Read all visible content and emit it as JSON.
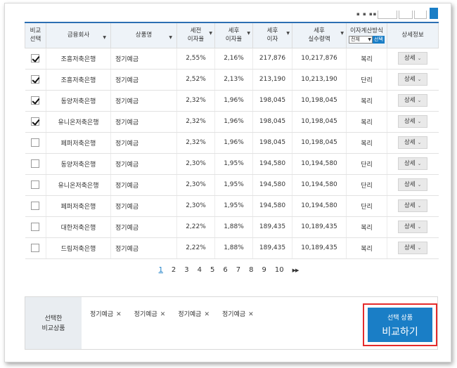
{
  "header": {
    "compare": "비교\n선택",
    "company": "금융회사",
    "product": "상품명",
    "pretax_rate": "세전\n이자율",
    "posttax_rate": "세후\n이자율",
    "posttax_interest": "세후\n이자",
    "posttax_payout": "세후\n실수령액",
    "calc_method": "이자계산방식",
    "calc_select_value": "전체",
    "calc_select_button": "선택",
    "detail_info": "상세정보"
  },
  "detail_label": "상세",
  "rows": [
    {
      "checked": true,
      "bank": "조흥저축은행",
      "product": "정기예금",
      "pretax": "2,55%",
      "posttax": "2,16%",
      "interest": "217,876",
      "payout": "10,217,876",
      "method": "복리"
    },
    {
      "checked": true,
      "bank": "조흥저축은행",
      "product": "정기예금",
      "pretax": "2,52%",
      "posttax": "2,13%",
      "interest": "213,190",
      "payout": "10,213,190",
      "method": "단리"
    },
    {
      "checked": true,
      "bank": "동양저축은행",
      "product": "정기예금",
      "pretax": "2,32%",
      "posttax": "1,96%",
      "interest": "198,045",
      "payout": "10,198,045",
      "method": "복리"
    },
    {
      "checked": true,
      "bank": "유니온저축은행",
      "product": "정기예금",
      "pretax": "2,32%",
      "posttax": "1,96%",
      "interest": "198,045",
      "payout": "10,198,045",
      "method": "복리"
    },
    {
      "checked": false,
      "bank": "페퍼저축은행",
      "product": "정기예금",
      "pretax": "2,32%",
      "posttax": "1,96%",
      "interest": "198,045",
      "payout": "10,198,045",
      "method": "복리"
    },
    {
      "checked": false,
      "bank": "동양저축은행",
      "product": "정기예금",
      "pretax": "2,30%",
      "posttax": "1,95%",
      "interest": "194,580",
      "payout": "10,194,580",
      "method": "단리"
    },
    {
      "checked": false,
      "bank": "유니온저축은행",
      "product": "정기예금",
      "pretax": "2,30%",
      "posttax": "1,95%",
      "interest": "194,580",
      "payout": "10,194,580",
      "method": "단리"
    },
    {
      "checked": false,
      "bank": "페퍼저축은행",
      "product": "정기예금",
      "pretax": "2,30%",
      "posttax": "1,95%",
      "interest": "194,580",
      "payout": "10,194,580",
      "method": "단리"
    },
    {
      "checked": false,
      "bank": "대한저축은행",
      "product": "정기예금",
      "pretax": "2,22%",
      "posttax": "1,88%",
      "interest": "189,435",
      "payout": "10,189,435",
      "method": "복리"
    },
    {
      "checked": false,
      "bank": "드림저축은행",
      "product": "정기예금",
      "pretax": "2,22%",
      "posttax": "1,88%",
      "interest": "189,435",
      "payout": "10,189,435",
      "method": "복리"
    }
  ],
  "pagination": {
    "pages": [
      "1",
      "2",
      "3",
      "4",
      "5",
      "6",
      "7",
      "8",
      "9",
      "10"
    ],
    "active": "1",
    "next": "▶▶"
  },
  "selection": {
    "label": "선택한\n비교상품",
    "chips": [
      "정기예금",
      "정기예금",
      "정기예금",
      "정기예금"
    ],
    "remove_glyph": "✕"
  },
  "compare_button": {
    "sub": "선택 상품",
    "main": "비교하기"
  },
  "colors": {
    "accent": "#1a7ec6",
    "highlight_border": "#e52b2b",
    "header_bg": "#eef3f8"
  }
}
